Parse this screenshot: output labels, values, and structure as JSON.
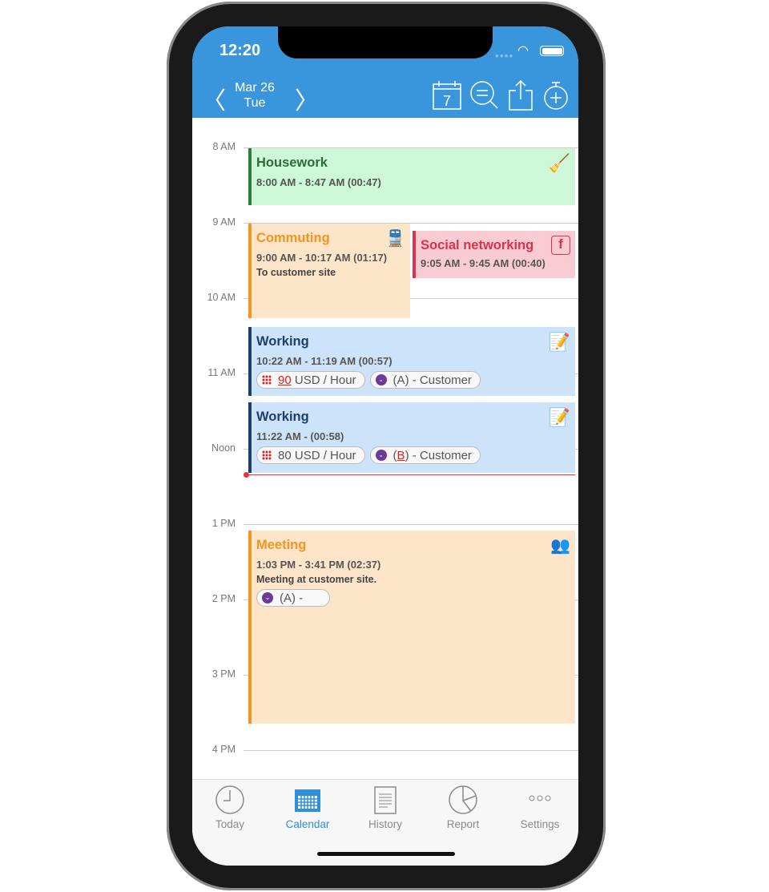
{
  "status": {
    "time": "12:20"
  },
  "header": {
    "date": "Mar 26",
    "weekday": "Tue",
    "calendar_day": "7"
  },
  "hours": [
    "8 AM",
    "9 AM",
    "10 AM",
    "11 AM",
    "Noon",
    "1 PM",
    "2 PM",
    "3 PM",
    "4 PM"
  ],
  "events": [
    {
      "title": "Housework",
      "time": "8:00 AM - 8:47 AM (00:47)",
      "icon": "broom-icon"
    },
    {
      "title": "Commuting",
      "time": "9:00 AM - 10:17 AM (01:17)",
      "note": "To customer site",
      "icon": "train-icon"
    },
    {
      "title": "Social networking",
      "time": "9:05 AM - 9:45 AM (00:40)",
      "icon": "facebook-icon"
    },
    {
      "title": "Working",
      "time": "10:22 AM - 11:19 AM (00:57)",
      "rate_value": "90",
      "rate_unit": "USD / Hour",
      "client_pre": "(",
      "client_letter": "A",
      "client_post": ") - Customer",
      "icon": "edit-list-icon"
    },
    {
      "title": "Working",
      "time": "11:22 AM -  (00:58)",
      "rate_value": "80",
      "rate_unit": "USD / Hour",
      "client_pre": "(",
      "client_letter": "B",
      "client_post": ") - Customer",
      "icon": "edit-list-icon"
    },
    {
      "title": "Meeting",
      "time": "1:03 PM - 3:41 PM (02:37)",
      "note": "Meeting at customer site.",
      "client": "(A) -",
      "icon": "people-icon"
    }
  ],
  "tabs": [
    {
      "label": "Today"
    },
    {
      "label": "Calendar"
    },
    {
      "label": "History"
    },
    {
      "label": "Report"
    },
    {
      "label": "Settings"
    }
  ],
  "colors": {
    "header": "#3a96dc",
    "now_line": "#e8303a"
  }
}
